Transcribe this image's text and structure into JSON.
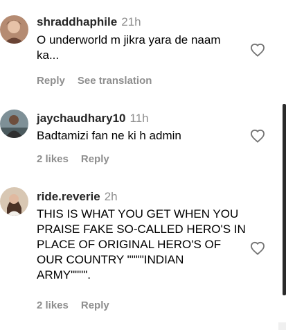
{
  "comments": [
    {
      "username": "shraddhaphile",
      "time": "21h",
      "text_line1": "O underworld m jikra yara de naam",
      "text_line2": "ka...",
      "reply": "Reply",
      "see_translation": "See translation",
      "avatar_colors": [
        "#7a5a4a",
        "#d9b49a"
      ]
    },
    {
      "username": "jaychaudhary10",
      "time": "11h",
      "text": "Badtamizi fan ne ki h admin",
      "likes": "2 likes",
      "reply": "Reply",
      "avatar_colors": [
        "#6b7f86",
        "#3a3a3a"
      ]
    },
    {
      "username": "ride.reverie",
      "time": "2h",
      "text_lines": [
        "THIS IS WHAT YOU GET WHEN YOU",
        "PRAISE FAKE SO-CALLED HERO'S IN",
        "PLACE OF ORIGINAL HERO'S OF",
        "OUR COUNTRY \"\"\"\"INDIAN",
        "ARMY\"\"\"\"."
      ],
      "likes": "2 likes",
      "reply": "Reply",
      "avatar_colors": [
        "#d8c7b3",
        "#5c4030"
      ]
    }
  ]
}
